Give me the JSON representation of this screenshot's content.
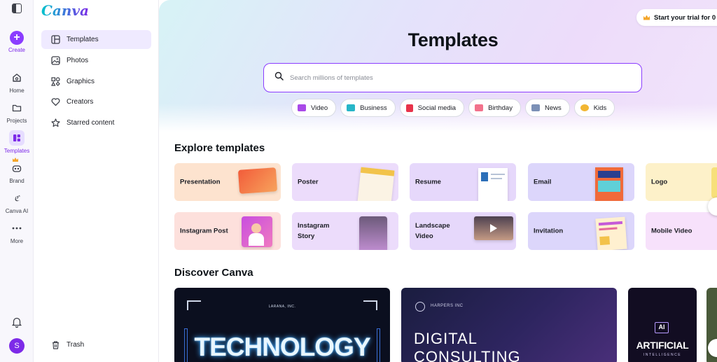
{
  "rail": {
    "create": "Create",
    "home": "Home",
    "projects": "Projects",
    "templates": "Templates",
    "brand": "Brand",
    "canva_ai": "Canva AI",
    "more": "More",
    "avatar_initial": "S"
  },
  "panel": {
    "logo": "Canva",
    "items": [
      {
        "label": "Templates",
        "icon": "template-icon"
      },
      {
        "label": "Photos",
        "icon": "image-icon"
      },
      {
        "label": "Graphics",
        "icon": "shapes-icon"
      },
      {
        "label": "Creators",
        "icon": "heart-icon"
      },
      {
        "label": "Starred content",
        "icon": "star-icon"
      }
    ],
    "trash": "Trash"
  },
  "header": {
    "trial": "Start your trial for 0",
    "title": "Templates",
    "search_placeholder": "Search millions of templates"
  },
  "chips": [
    {
      "label": "Video",
      "color": "#a94ae8"
    },
    {
      "label": "Business",
      "color": "#27b6c8"
    },
    {
      "label": "Social media",
      "color": "#e8334a"
    },
    {
      "label": "Birthday",
      "color": "#f2728c"
    },
    {
      "label": "News",
      "color": "#7b90b6"
    },
    {
      "label": "Kids",
      "color": "#f2b632"
    }
  ],
  "explore": {
    "title": "Explore templates",
    "row1": [
      "Presentation",
      "Poster",
      "Resume",
      "Email",
      "Logo"
    ],
    "row2": [
      "Instagram Post",
      "Instagram Story",
      "Landscape Video",
      "Invitation",
      "Mobile Video"
    ]
  },
  "discover": {
    "title": "Discover Canva",
    "card1": {
      "small": "LARANA, INC.",
      "big": "TECHNOLOGY"
    },
    "card2": {
      "small": "HARPERS INC",
      "big1": "DIGITAL",
      "big2": "CONSULTING"
    },
    "card3": {
      "badge": "AI",
      "big": "ARTIFICIAL",
      "small": "INTELLIGENCE"
    }
  }
}
